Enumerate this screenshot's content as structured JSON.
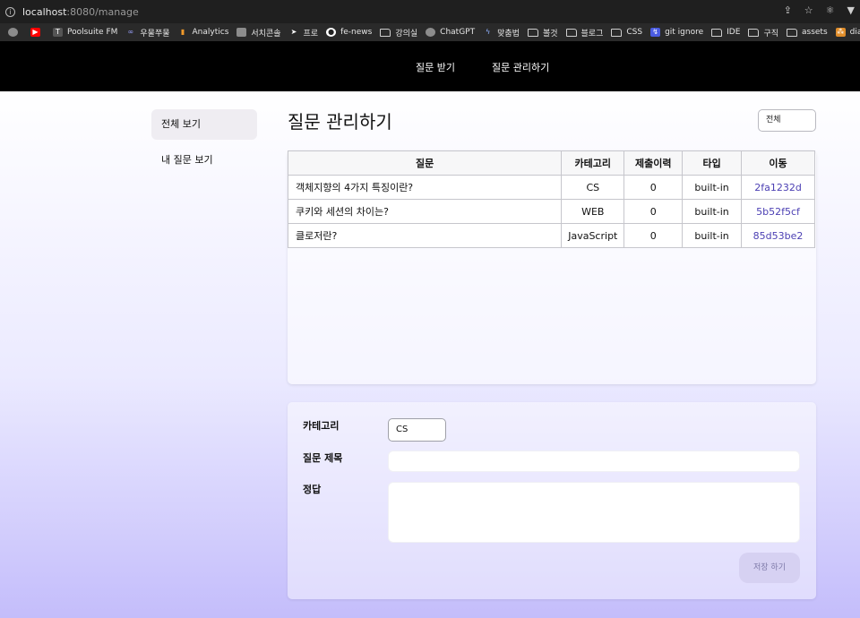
{
  "browser": {
    "url_host": "localhost",
    "url_rest": ":8080/manage",
    "bookmarks": [
      {
        "label": "",
        "icon": "youtube-icon"
      },
      {
        "label": "Poolsuite FM",
        "icon": "t-icon"
      },
      {
        "label": "우물쭈물",
        "icon": "infinity-icon"
      },
      {
        "label": "Analytics",
        "icon": "analytics-icon"
      },
      {
        "label": "서치콘솔",
        "icon": "console-icon"
      },
      {
        "label": "프로",
        "icon": "arrow-icon"
      },
      {
        "label": "fe-news",
        "icon": "github-icon"
      },
      {
        "label": "강의실",
        "icon": "folder-icon"
      },
      {
        "label": "ChatGPT",
        "icon": "chatgpt-icon"
      },
      {
        "label": "맞춤법",
        "icon": "bolt-icon"
      },
      {
        "label": "볼것",
        "icon": "folder-icon"
      },
      {
        "label": "블로그",
        "icon": "folder-icon"
      },
      {
        "label": "CSS",
        "icon": "folder-icon"
      },
      {
        "label": "git ignore",
        "icon": "git-icon"
      },
      {
        "label": "IDE",
        "icon": "folder-icon"
      },
      {
        "label": "구직",
        "icon": "folder-icon"
      },
      {
        "label": "assets",
        "icon": "folder-icon"
      },
      {
        "label": "diagrams",
        "icon": "diagrams-icon"
      }
    ]
  },
  "nav": {
    "links": [
      "질문 받기",
      "질문 관리하기"
    ]
  },
  "sidebar": {
    "items": [
      {
        "label": "전체 보기",
        "active": true
      },
      {
        "label": "내 질문 보기",
        "active": false
      }
    ]
  },
  "main": {
    "title": "질문 관리하기",
    "filter_value": "전체"
  },
  "table": {
    "headers": [
      "질문",
      "카테고리",
      "제출이력",
      "타입",
      "이동"
    ],
    "rows": [
      [
        "객체지향의 4가지 특징이란?",
        "CS",
        "0",
        "built-in",
        "2fa1232d"
      ],
      [
        "쿠키와 세션의 차이는?",
        "WEB",
        "0",
        "built-in",
        "5b52f5cf"
      ],
      [
        "클로저란?",
        "JavaScript",
        "0",
        "built-in",
        "85d53be2"
      ]
    ]
  },
  "form": {
    "category_label": "카테고리",
    "category_value": "CS",
    "title_label": "질문 제목",
    "title_value": "",
    "answer_label": "정답",
    "answer_value": "",
    "save_label": "저장 하기"
  }
}
